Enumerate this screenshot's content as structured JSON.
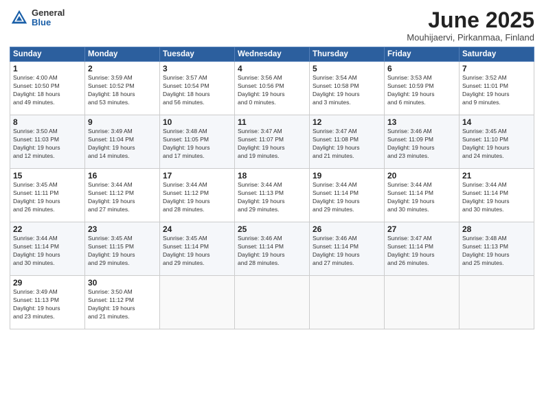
{
  "header": {
    "logo_general": "General",
    "logo_blue": "Blue",
    "month_title": "June 2025",
    "location": "Mouhijaervi, Pirkanmaa, Finland"
  },
  "weekdays": [
    "Sunday",
    "Monday",
    "Tuesday",
    "Wednesday",
    "Thursday",
    "Friday",
    "Saturday"
  ],
  "weeks": [
    [
      {
        "day": "1",
        "info": "Sunrise: 4:00 AM\nSunset: 10:50 PM\nDaylight: 18 hours\nand 49 minutes."
      },
      {
        "day": "2",
        "info": "Sunrise: 3:59 AM\nSunset: 10:52 PM\nDaylight: 18 hours\nand 53 minutes."
      },
      {
        "day": "3",
        "info": "Sunrise: 3:57 AM\nSunset: 10:54 PM\nDaylight: 18 hours\nand 56 minutes."
      },
      {
        "day": "4",
        "info": "Sunrise: 3:56 AM\nSunset: 10:56 PM\nDaylight: 19 hours\nand 0 minutes."
      },
      {
        "day": "5",
        "info": "Sunrise: 3:54 AM\nSunset: 10:58 PM\nDaylight: 19 hours\nand 3 minutes."
      },
      {
        "day": "6",
        "info": "Sunrise: 3:53 AM\nSunset: 10:59 PM\nDaylight: 19 hours\nand 6 minutes."
      },
      {
        "day": "7",
        "info": "Sunrise: 3:52 AM\nSunset: 11:01 PM\nDaylight: 19 hours\nand 9 minutes."
      }
    ],
    [
      {
        "day": "8",
        "info": "Sunrise: 3:50 AM\nSunset: 11:03 PM\nDaylight: 19 hours\nand 12 minutes."
      },
      {
        "day": "9",
        "info": "Sunrise: 3:49 AM\nSunset: 11:04 PM\nDaylight: 19 hours\nand 14 minutes."
      },
      {
        "day": "10",
        "info": "Sunrise: 3:48 AM\nSunset: 11:05 PM\nDaylight: 19 hours\nand 17 minutes."
      },
      {
        "day": "11",
        "info": "Sunrise: 3:47 AM\nSunset: 11:07 PM\nDaylight: 19 hours\nand 19 minutes."
      },
      {
        "day": "12",
        "info": "Sunrise: 3:47 AM\nSunset: 11:08 PM\nDaylight: 19 hours\nand 21 minutes."
      },
      {
        "day": "13",
        "info": "Sunrise: 3:46 AM\nSunset: 11:09 PM\nDaylight: 19 hours\nand 23 minutes."
      },
      {
        "day": "14",
        "info": "Sunrise: 3:45 AM\nSunset: 11:10 PM\nDaylight: 19 hours\nand 24 minutes."
      }
    ],
    [
      {
        "day": "15",
        "info": "Sunrise: 3:45 AM\nSunset: 11:11 PM\nDaylight: 19 hours\nand 26 minutes."
      },
      {
        "day": "16",
        "info": "Sunrise: 3:44 AM\nSunset: 11:12 PM\nDaylight: 19 hours\nand 27 minutes."
      },
      {
        "day": "17",
        "info": "Sunrise: 3:44 AM\nSunset: 11:12 PM\nDaylight: 19 hours\nand 28 minutes."
      },
      {
        "day": "18",
        "info": "Sunrise: 3:44 AM\nSunset: 11:13 PM\nDaylight: 19 hours\nand 29 minutes."
      },
      {
        "day": "19",
        "info": "Sunrise: 3:44 AM\nSunset: 11:14 PM\nDaylight: 19 hours\nand 29 minutes."
      },
      {
        "day": "20",
        "info": "Sunrise: 3:44 AM\nSunset: 11:14 PM\nDaylight: 19 hours\nand 30 minutes."
      },
      {
        "day": "21",
        "info": "Sunrise: 3:44 AM\nSunset: 11:14 PM\nDaylight: 19 hours\nand 30 minutes."
      }
    ],
    [
      {
        "day": "22",
        "info": "Sunrise: 3:44 AM\nSunset: 11:14 PM\nDaylight: 19 hours\nand 30 minutes."
      },
      {
        "day": "23",
        "info": "Sunrise: 3:45 AM\nSunset: 11:15 PM\nDaylight: 19 hours\nand 29 minutes."
      },
      {
        "day": "24",
        "info": "Sunrise: 3:45 AM\nSunset: 11:14 PM\nDaylight: 19 hours\nand 29 minutes."
      },
      {
        "day": "25",
        "info": "Sunrise: 3:46 AM\nSunset: 11:14 PM\nDaylight: 19 hours\nand 28 minutes."
      },
      {
        "day": "26",
        "info": "Sunrise: 3:46 AM\nSunset: 11:14 PM\nDaylight: 19 hours\nand 27 minutes."
      },
      {
        "day": "27",
        "info": "Sunrise: 3:47 AM\nSunset: 11:14 PM\nDaylight: 19 hours\nand 26 minutes."
      },
      {
        "day": "28",
        "info": "Sunrise: 3:48 AM\nSunset: 11:13 PM\nDaylight: 19 hours\nand 25 minutes."
      }
    ],
    [
      {
        "day": "29",
        "info": "Sunrise: 3:49 AM\nSunset: 11:13 PM\nDaylight: 19 hours\nand 23 minutes."
      },
      {
        "day": "30",
        "info": "Sunrise: 3:50 AM\nSunset: 11:12 PM\nDaylight: 19 hours\nand 21 minutes."
      },
      {
        "day": "",
        "info": ""
      },
      {
        "day": "",
        "info": ""
      },
      {
        "day": "",
        "info": ""
      },
      {
        "day": "",
        "info": ""
      },
      {
        "day": "",
        "info": ""
      }
    ]
  ]
}
